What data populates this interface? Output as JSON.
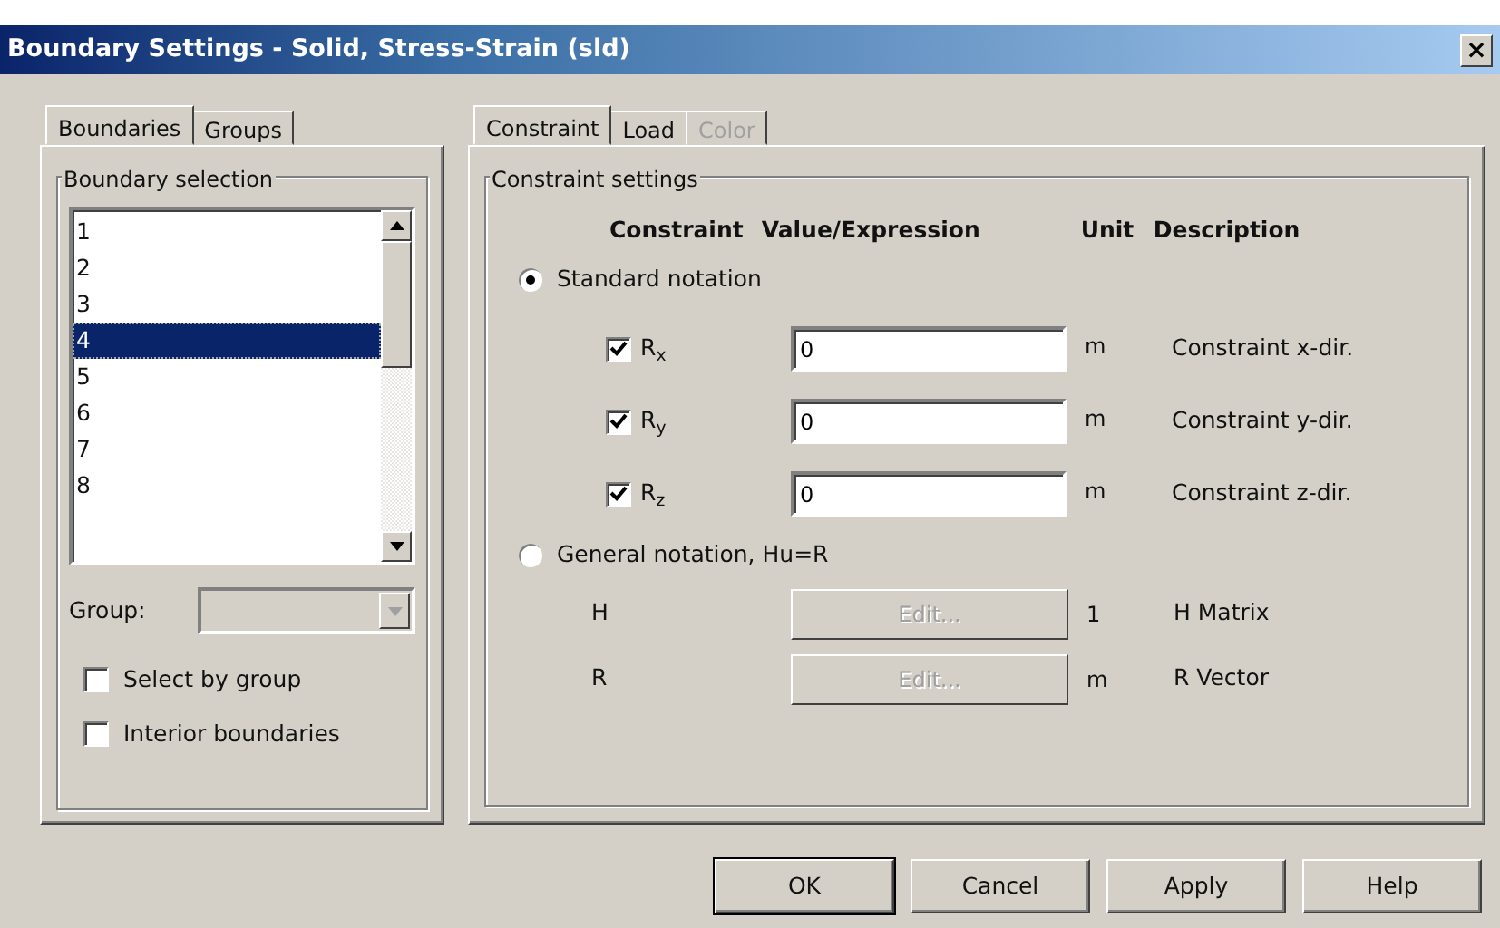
{
  "window": {
    "title": "Boundary Settings - Solid, Stress-Strain (sld)",
    "close": "×"
  },
  "left_tabs": [
    {
      "label": "Boundaries",
      "selected": true
    },
    {
      "label": "Groups",
      "selected": false
    }
  ],
  "boundary_selection": {
    "title": "Boundary selection",
    "items": [
      {
        "label": "1",
        "selected": false
      },
      {
        "label": "2",
        "selected": false
      },
      {
        "label": "3",
        "selected": false
      },
      {
        "label": "4",
        "selected": true
      },
      {
        "label": "5",
        "selected": false
      },
      {
        "label": "6",
        "selected": false
      },
      {
        "label": "7",
        "selected": false
      },
      {
        "label": "8",
        "selected": false
      }
    ],
    "group_label": "Group:",
    "group_disabled": true,
    "checkboxes": [
      {
        "label": "Select by group",
        "checked": false
      },
      {
        "label": "Interior boundaries",
        "checked": false
      }
    ]
  },
  "right_tabs": [
    {
      "label": "Constraint",
      "selected": true,
      "disabled": false
    },
    {
      "label": "Load",
      "selected": false,
      "disabled": false
    },
    {
      "label": "Color",
      "selected": false,
      "disabled": true
    }
  ],
  "constraint_settings": {
    "title": "Constraint settings",
    "columns": [
      "Constraint",
      "Value/Expression",
      "Unit",
      "Description"
    ],
    "notations": [
      {
        "label": "Standard notation",
        "selected": true
      },
      {
        "label": "General notation, Hu=R",
        "selected": false
      }
    ],
    "standard_rows": [
      {
        "label": "R$_{x}$",
        "checked": true,
        "value": "0",
        "unit": "m",
        "description": "Constraint x-dir."
      },
      {
        "label": "R$_{y}$",
        "checked": true,
        "value": "0",
        "unit": "m",
        "description": "Constraint y-dir."
      },
      {
        "label": "R$_{z}$",
        "checked": true,
        "value": "0",
        "unit": "m",
        "description": "Constraint z-dir."
      }
    ],
    "general_rows": [
      {
        "label": "H",
        "button": "Edit...",
        "disabled": true,
        "unit": "1",
        "description": "H Matrix"
      },
      {
        "label": "R",
        "button": "Edit...",
        "disabled": true,
        "unit": "m",
        "description": "R Vector"
      }
    ]
  },
  "buttons": [
    "OK",
    "Cancel",
    "Apply",
    "Help"
  ]
}
